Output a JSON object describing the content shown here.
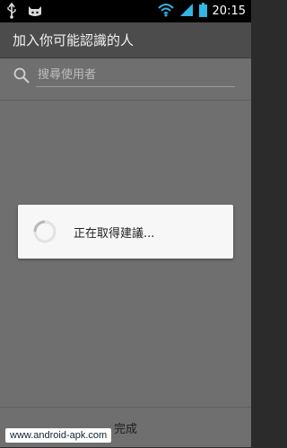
{
  "status_bar": {
    "time": "20:15",
    "icons": [
      "usb-icon",
      "android-cat-icon",
      "wifi-icon",
      "signal-icon",
      "battery-icon"
    ]
  },
  "header": {
    "title": "加入你可能認識的人"
  },
  "search": {
    "placeholder": "搜尋使用者"
  },
  "dialog": {
    "message": "正在取得建議..."
  },
  "footer": {
    "done_label": "完成"
  },
  "watermark": {
    "text": "www.android-apk.com"
  },
  "colors": {
    "status_bar": "#000000",
    "header_bg": "#4c4c4c",
    "app_bg": "#6f6f6f",
    "dialog_bg": "#f7f7f7",
    "wifi_accent": "#33b5e5"
  }
}
